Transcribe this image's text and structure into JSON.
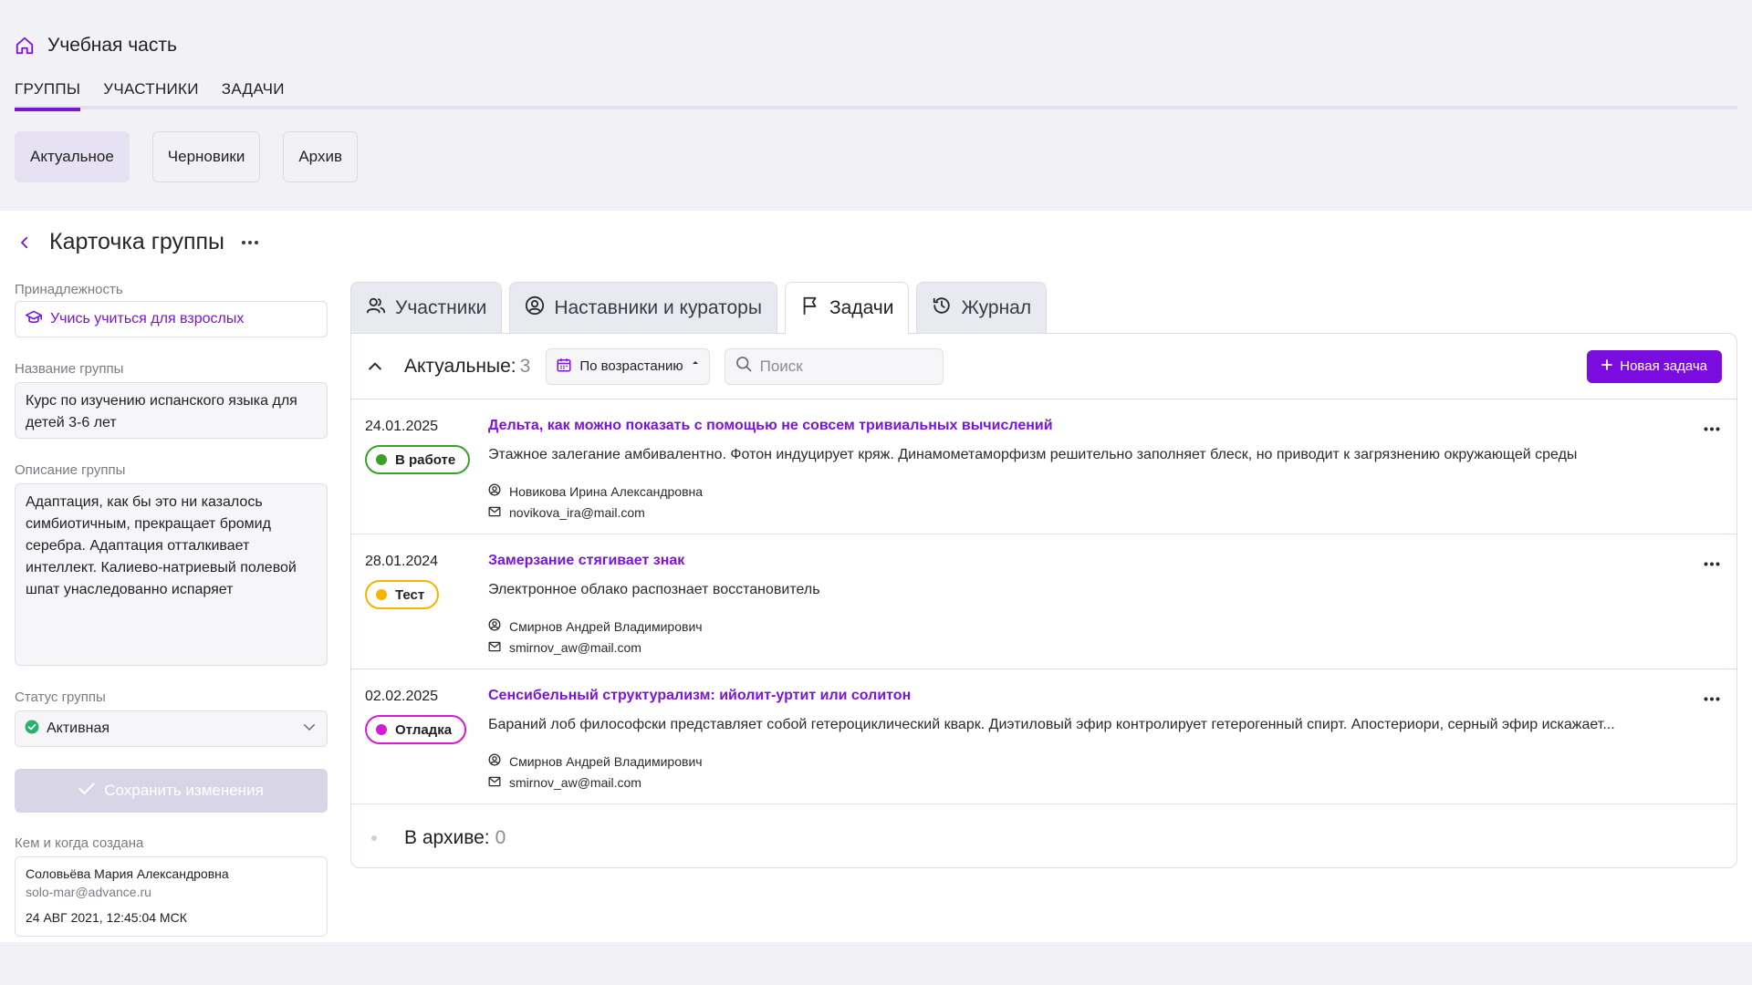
{
  "header": {
    "title": "Учебная часть",
    "tabs": [
      {
        "label": "ГРУППЫ"
      },
      {
        "label": "УЧАСТНИКИ"
      },
      {
        "label": "ЗАДАЧИ"
      }
    ],
    "subtabs": [
      {
        "label": "Актуальное"
      },
      {
        "label": "Черновики"
      },
      {
        "label": "Архив"
      }
    ]
  },
  "card": {
    "title": "Карточка группы"
  },
  "left": {
    "belonging_label": "Принадлежность",
    "belonging_value": "Учись учиться для взрослых",
    "name_label": "Название группы",
    "name_value": "Курс по изучению испанского языка для детей 3-6 лет",
    "description_label": "Описание группы",
    "description_value": "Адаптация, как бы это ни казалось симбиотичным, прекращает бромид серебра. Адаптация отталкивает интеллект. Калиево-натриевый полевой шпат унаследованно испаряет",
    "status_label": "Статус группы",
    "status_value": "Активная",
    "save_label": "Сохранить изменения",
    "created_label": "Кем и когда создана",
    "created_name": "Соловьёва Мария Александровна",
    "created_email": "solo-mar@advance.ru",
    "created_date": "24 АВГ 2021, 12:45:04 МСК"
  },
  "right_tabs": [
    {
      "label": "Участники",
      "icon": "users-icon"
    },
    {
      "label": "Наставники и кураторы",
      "icon": "user-circle-icon"
    },
    {
      "label": "Задачи",
      "icon": "flag-icon"
    },
    {
      "label": "Журнал",
      "icon": "history-icon"
    }
  ],
  "tasks": {
    "section_title": "Актуальные:",
    "section_count": "3",
    "sort_label": "По возрастанию",
    "search_placeholder": "Поиск",
    "new_task_label": "Новая задача",
    "items": [
      {
        "date": "24.01.2025",
        "status": "В работе",
        "status_color": "#3aa02a",
        "title": "Дельта, как можно показать с помощью не совсем тривиальных вычислений",
        "description": "Этажное залегание амбивалентно. Фотон индуцирует кряж. Динамометаморфизм решительно заполняет блеск, но приводит к загрязнению окружающей среды",
        "person": "Новикова Ирина Александровна",
        "email": "novikova_ira@mail.com"
      },
      {
        "date": "28.01.2024",
        "status": "Тест",
        "status_color": "#f4b400",
        "title": "Замерзание стягивает знак",
        "description": "Электронное облако распознает восстановитель",
        "person": "Смирнов Андрей Владимирович",
        "email": "smirnov_aw@mail.com"
      },
      {
        "date": "02.02.2025",
        "status": "Отладка",
        "status_color": "#d61ad6",
        "title": "Сенсибельный структурализм: ийолит-уртит или солитон",
        "description": "Бараний лоб философски представляет собой гетероциклический кварк. Диэтиловый эфир контролирует гетерогенный спирт. Апостериори, серный эфир искажает...",
        "person": "Смирнов Андрей Владимирович",
        "email": "smirnov_aw@mail.com"
      }
    ],
    "archive_title": "В архиве:",
    "archive_count": "0"
  },
  "colors": {
    "accent": "#7a0ce0",
    "link": "#7a14d6",
    "active_status": "#27b36b"
  }
}
